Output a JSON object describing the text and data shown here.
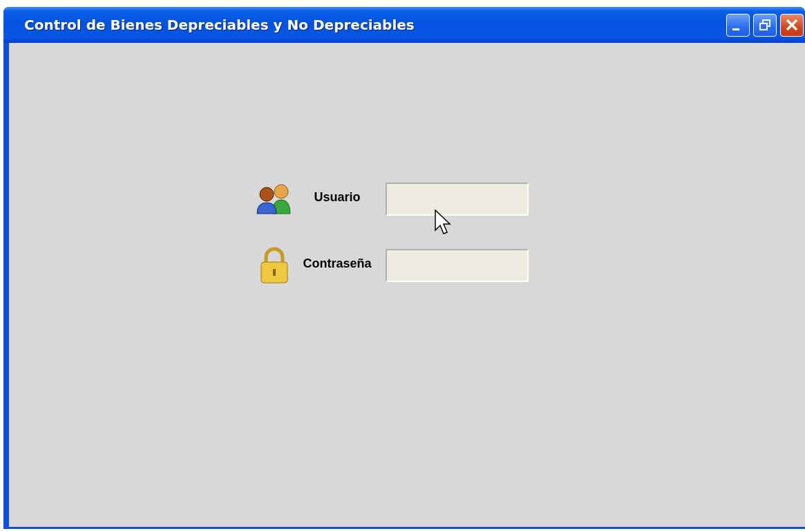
{
  "window": {
    "title": "Control de Bienes Depreciables y No Depreciables"
  },
  "login": {
    "fields": [
      {
        "kind": "user",
        "label": "Usuario"
      },
      {
        "kind": "password",
        "label": "Contraseña"
      }
    ]
  }
}
